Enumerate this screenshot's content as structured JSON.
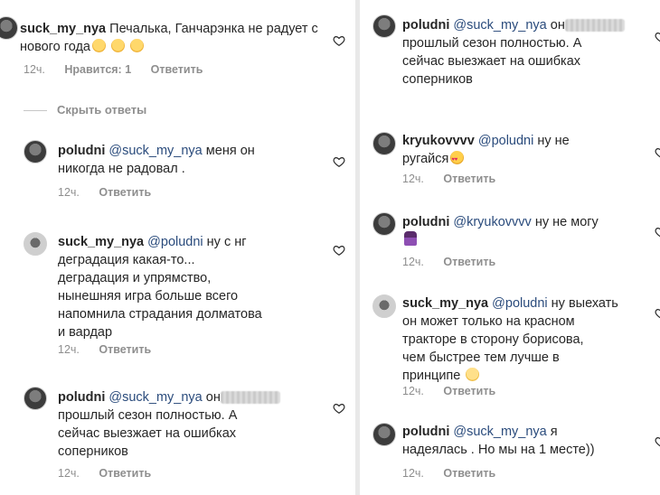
{
  "left": {
    "top_comment": {
      "username": "suck_my_nya",
      "text": "Печалька, Ганчарэнка не радует с нового года",
      "emojis": [
        "sad-face",
        "sad-face",
        "sad-face"
      ],
      "time": "12ч.",
      "likes": "Нравится: 1",
      "reply": "Ответить"
    },
    "hide_replies": "Скрыть ответы",
    "replies": [
      {
        "username": "poludni",
        "mention": "@suck_my_nya",
        "lines": [
          "меня он",
          "никогда не радовал ."
        ],
        "time": "12ч.",
        "reply": "Ответить"
      },
      {
        "username": "suck_my_nya",
        "mention": "@poludni",
        "lines": [
          "ну с нг",
          "деградация какая-то...",
          "деградация и упрямство,",
          "нынешняя игра больше всего",
          "напомнила страдания долматова",
          "и вардар"
        ],
        "time": "12ч.",
        "reply": "Ответить"
      },
      {
        "username": "poludni",
        "mention": "@suck_my_nya",
        "lines": [
          "он",
          "прошлый сезон полностью. А",
          "сейчас выезжает на ошибках",
          "соперников"
        ],
        "time": "12ч.",
        "reply": "Ответить"
      }
    ]
  },
  "right": {
    "replies": [
      {
        "username": "poludni",
        "mention": "@suck_my_nya",
        "lines": [
          "он",
          "прошлый сезон полностью. А",
          "сейчас выезжает на ошибках",
          "соперников"
        ],
        "time": "",
        "reply": ""
      },
      {
        "username": "kryukovvvv",
        "mention": "@poludni",
        "lines": [
          "ну не",
          "ругайся"
        ],
        "time": "12ч.",
        "reply": "Ответить"
      },
      {
        "username": "poludni",
        "mention": "@kryukovvvv",
        "lines": [
          "ну не могу",
          ""
        ],
        "time": "12ч.",
        "reply": "Ответить"
      },
      {
        "username": "suck_my_nya",
        "mention": "@poludni",
        "lines": [
          "ну выехать",
          "он может только на красном",
          "тракторе в сторону борисова,",
          "чем быстрее тем лучше в",
          "принципе"
        ],
        "time": "12ч.",
        "reply": "Ответить"
      },
      {
        "username": "poludni",
        "mention": "@suck_my_nya",
        "lines": [
          "я",
          "надеялась . Но мы на 1 месте))"
        ],
        "time": "12ч.",
        "reply": "Ответить"
      }
    ]
  },
  "colors": {
    "text": "#262626",
    "meta": "#8e8e8e",
    "mention": "#2a4b7c"
  },
  "icons": [
    "heart-icon",
    "avatar"
  ]
}
